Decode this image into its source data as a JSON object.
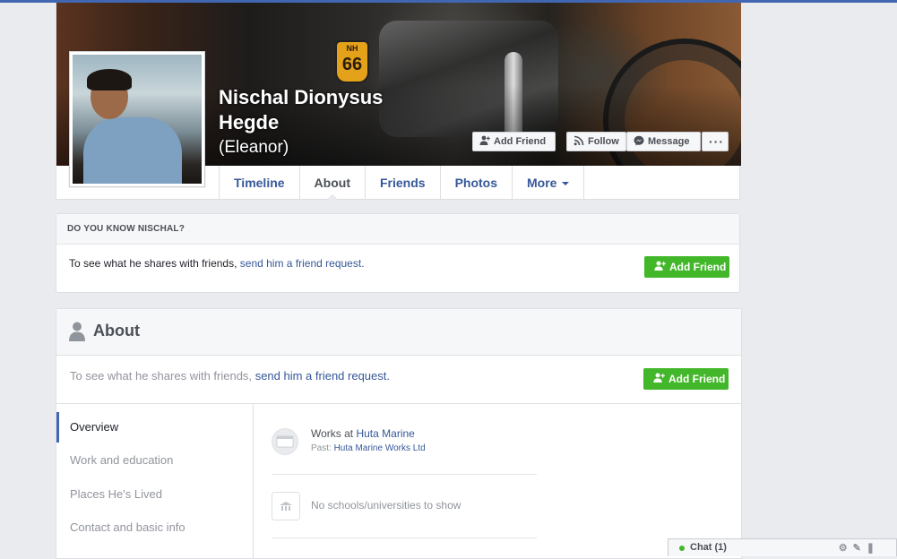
{
  "profile": {
    "name": "Nischal Dionysus Hegde",
    "alternate_name": "(Eleanor)",
    "cover_plate_top": "NH",
    "cover_plate_number": "66"
  },
  "cover_actions": {
    "add_friend": "Add Friend",
    "follow": "Follow",
    "message": "Message",
    "more": "···"
  },
  "tabs": [
    {
      "label": "Timeline"
    },
    {
      "label": "About",
      "active": true
    },
    {
      "label": "Friends"
    },
    {
      "label": "Photos"
    },
    {
      "label": "More"
    }
  ],
  "know_box": {
    "heading": "DO YOU KNOW NISCHAL?",
    "text_prefix": "To see what he shares with friends,",
    "link": "send him a friend request.",
    "button": "Add Friend"
  },
  "about": {
    "title": "About",
    "notice_prefix": "To see what he shares with friends,",
    "notice_link": "send him a friend request.",
    "button": "Add Friend",
    "nav": [
      {
        "label": "Overview",
        "active": true
      },
      {
        "label": "Work and education"
      },
      {
        "label": "Places He's Lived"
      },
      {
        "label": "Contact and basic info"
      }
    ],
    "work": {
      "prefix": "Works at",
      "employer": "Huta Marine",
      "past_label": "Past:",
      "past_employer": "Huta Marine Works Ltd"
    },
    "education": {
      "text": "No schools/universities to show"
    }
  },
  "chat": {
    "label": "Chat (1)"
  },
  "colors": {
    "brand_blue": "#4267b2",
    "link_blue": "#365899",
    "green": "#42b72a",
    "background": "#e9ebee"
  }
}
